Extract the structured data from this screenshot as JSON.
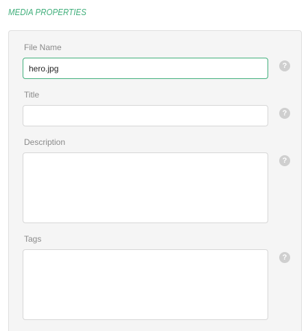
{
  "section": {
    "title": "MEDIA PROPERTIES"
  },
  "fields": {
    "file_name": {
      "label": "File Name",
      "value": "hero.jpg"
    },
    "title": {
      "label": "Title",
      "value": ""
    },
    "description": {
      "label": "Description",
      "value": ""
    },
    "tags": {
      "label": "Tags",
      "value": ""
    }
  },
  "help_glyph": "?",
  "colors": {
    "accent": "#3fae7a",
    "panel_bg": "#f5f5f5",
    "label": "#8a8a8a",
    "help_icon": "#cfcfcf"
  },
  "icons": {
    "help": "help-circle-icon"
  }
}
